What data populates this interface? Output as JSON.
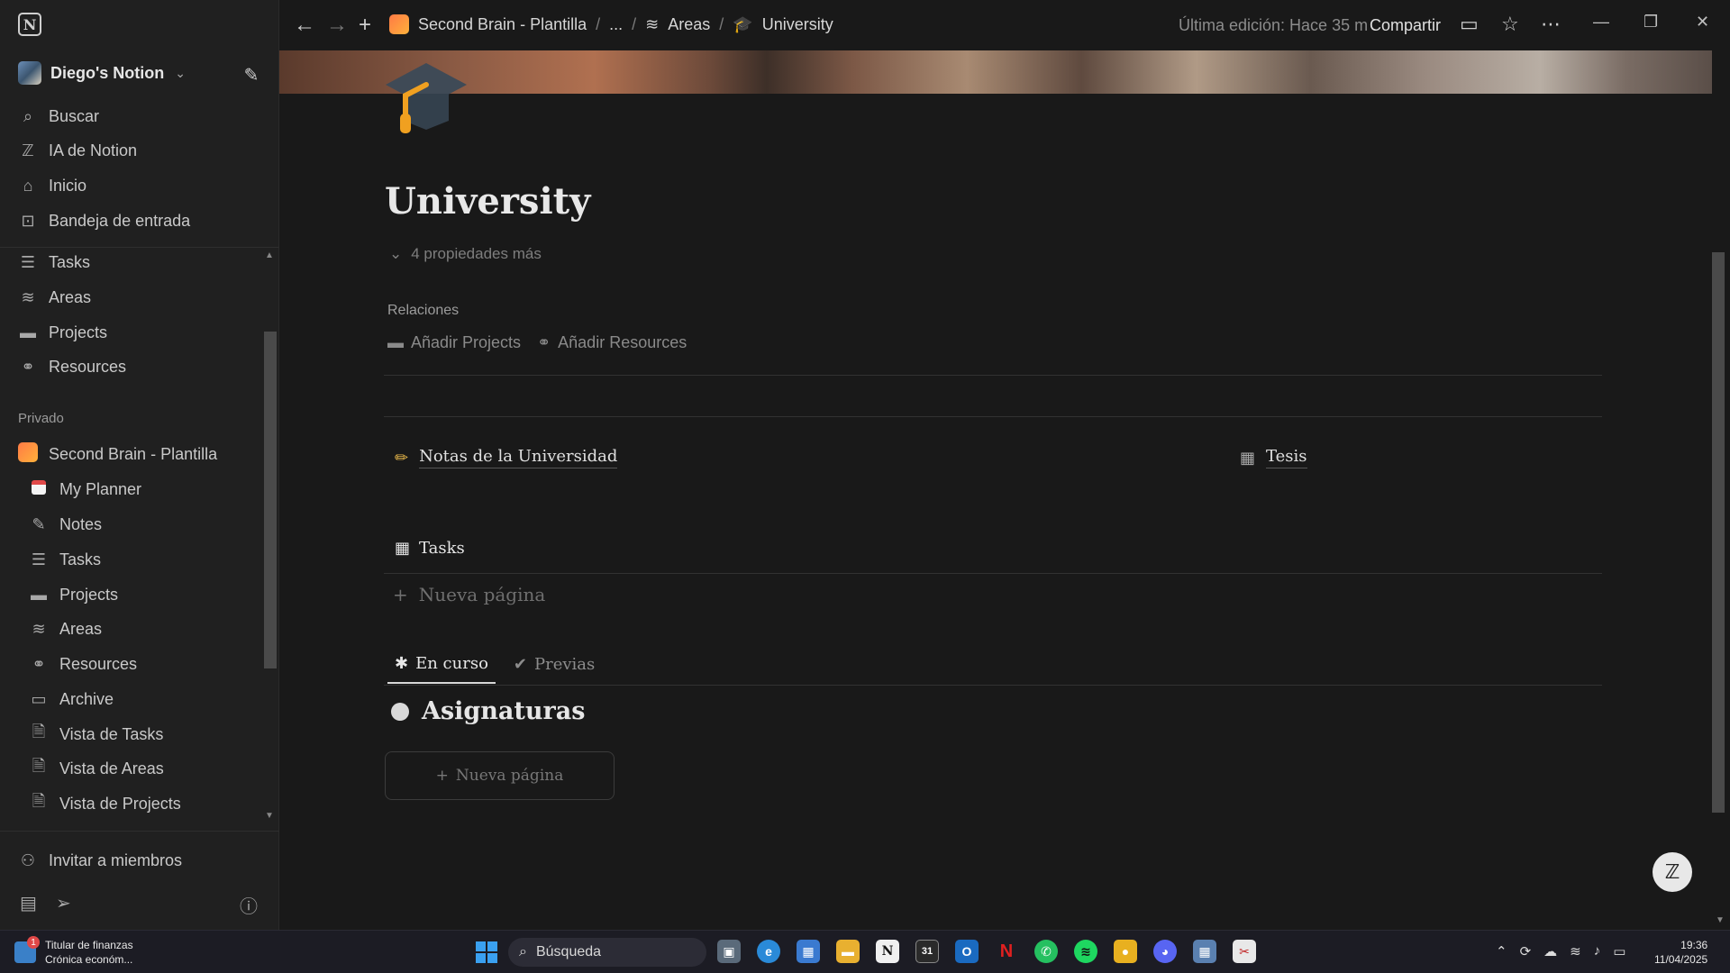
{
  "workspace": {
    "name": "Diego's Notion"
  },
  "sidebar": {
    "top_items": [
      {
        "label": "Buscar",
        "icon": "search-icon"
      },
      {
        "label": "IA de Notion",
        "icon": "notion-ai-icon"
      },
      {
        "label": "Inicio",
        "icon": "home-icon"
      },
      {
        "label": "Bandeja de entrada",
        "icon": "inbox-icon"
      }
    ],
    "favorites": [
      {
        "label": "Tasks",
        "icon": "checklist-icon"
      },
      {
        "label": "Areas",
        "icon": "layers-icon"
      },
      {
        "label": "Projects",
        "icon": "folder-icon"
      },
      {
        "label": "Resources",
        "icon": "link-icon"
      }
    ],
    "section_private": "Privado",
    "private_root": {
      "label": "Second Brain - Plantilla",
      "icon": "second-brain-icon"
    },
    "private_items": [
      {
        "label": "My Planner",
        "icon": "calendar-icon"
      },
      {
        "label": "Notes",
        "icon": "pencil-icon"
      },
      {
        "label": "Tasks",
        "icon": "checklist-icon"
      },
      {
        "label": "Projects",
        "icon": "folder-icon"
      },
      {
        "label": "Areas",
        "icon": "layers-icon"
      },
      {
        "label": "Resources",
        "icon": "link-icon"
      },
      {
        "label": "Archive",
        "icon": "archive-icon"
      },
      {
        "label": "Vista de Tasks",
        "icon": "page-view-icon"
      },
      {
        "label": "Vista de Areas",
        "icon": "page-view-icon"
      },
      {
        "label": "Vista de Projects",
        "icon": "page-view-icon"
      }
    ],
    "invite": "Invitar a miembros"
  },
  "topbar": {
    "breadcrumbs": [
      "Second Brain - Plantilla",
      "...",
      "Areas",
      "University"
    ],
    "last_edit": "Última edición: Hace 35 m",
    "share": "Compartir"
  },
  "page": {
    "title": "University",
    "more_props": "4 propiedades más",
    "relations_label": "Relaciones",
    "add_projects": "Añadir Projects",
    "add_resources": "Añadir Resources",
    "link_notes": "Notas de la Universidad",
    "link_tesis": "Tesis",
    "tasks_db": "Tasks",
    "new_page": "Nueva página",
    "tabs": [
      {
        "label": "En curso",
        "active": true
      },
      {
        "label": "Previas",
        "active": false
      }
    ],
    "group_title": "Asignaturas",
    "new_page_card": "Nueva página"
  },
  "taskbar": {
    "news_title": "Titular de finanzas",
    "news_sub": "Crónica económ...",
    "news_badge": "1",
    "search_placeholder": "Búsqueda",
    "time": "19:36",
    "date": "11/04/2025"
  }
}
